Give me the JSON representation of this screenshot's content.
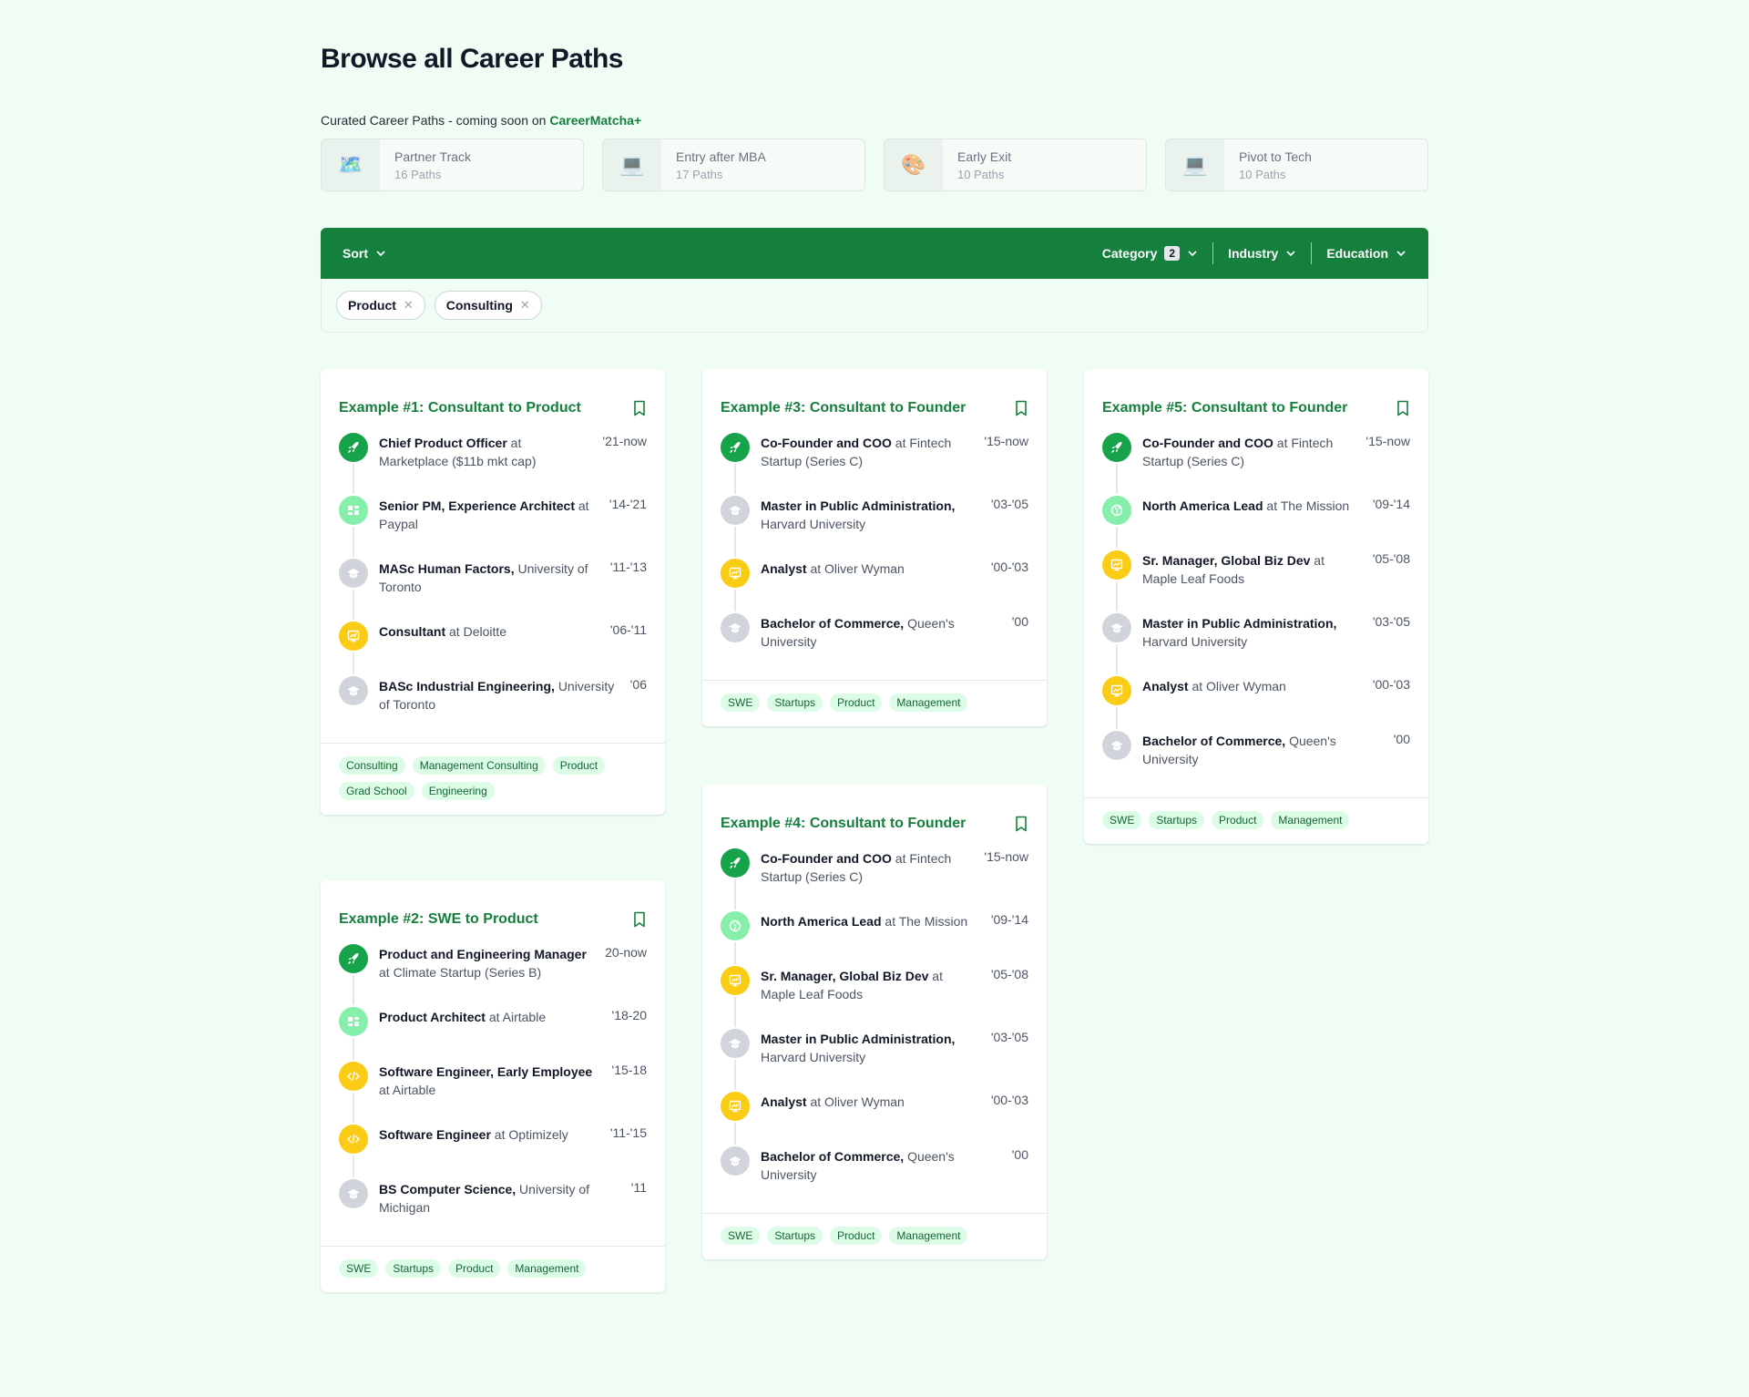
{
  "page_title": "Browse all Career Paths",
  "curated": {
    "prefix": "Curated Career Paths - coming soon on ",
    "brand": "CareerMatcha+"
  },
  "curated_paths": [
    {
      "name": "Partner Track",
      "count": "16 Paths",
      "icon": "🗺️"
    },
    {
      "name": "Entry after MBA",
      "count": "17 Paths",
      "icon": "💻"
    },
    {
      "name": "Early Exit",
      "count": "10 Paths",
      "icon": "🎨"
    },
    {
      "name": "Pivot to Tech",
      "count": "10 Paths",
      "icon": "💻"
    }
  ],
  "filterbar": {
    "sort": "Sort",
    "category": "Category",
    "category_count": "2",
    "industry": "Industry",
    "education": "Education"
  },
  "active_filters": [
    "Product",
    "Consulting"
  ],
  "colors": {
    "brand": "#15803d",
    "background": "#f0fdf4",
    "tag_bg": "#dcfce7"
  },
  "cards": [
    {
      "title": "Example #1: Consultant to Product",
      "items": [
        {
          "icon": "rocket",
          "role": "Chief Product Officer",
          "sep": " at ",
          "org": "Marketplace ($11b mkt cap)",
          "date": "'21-now"
        },
        {
          "icon": "board",
          "role": "Senior PM, Experience Architect",
          "sep": " at ",
          "org": "Paypal",
          "date": "'14-'21"
        },
        {
          "icon": "grad",
          "role": "MASc Human Factors,",
          "sep": " ",
          "org": "University of Toronto",
          "date": "'11-'13"
        },
        {
          "icon": "chart",
          "role": "Consultant",
          "sep": " at ",
          "org": "Deloitte",
          "date": "'06-'11"
        },
        {
          "icon": "grad",
          "role": "BASc Industrial Engineering,",
          "sep": " ",
          "org": "University of Toronto",
          "date": "'06"
        }
      ],
      "tags": [
        "Consulting",
        "Management Consulting",
        "Product",
        "Grad School",
        "Engineering"
      ]
    },
    {
      "title": "Example #2: SWE to Product",
      "items": [
        {
          "icon": "rocket",
          "role": "Product and Engineering Manager",
          "sep": " at ",
          "org": "Climate Startup (Series B)",
          "date": "20-now"
        },
        {
          "icon": "board",
          "role": "Product Architect",
          "sep": " at ",
          "org": "Airtable",
          "date": "'18-20"
        },
        {
          "icon": "code",
          "role": "Software Engineer, Early Employee",
          "sep": " at ",
          "org": "Airtable",
          "date": "'15-18"
        },
        {
          "icon": "code",
          "role": "Software Engineer",
          "sep": " at ",
          "org": "Optimizely",
          "date": "'11-'15"
        },
        {
          "icon": "grad",
          "role": "BS Computer Science,",
          "sep": " ",
          "org": "University of Michigan",
          "date": "'11"
        }
      ],
      "tags": [
        "SWE",
        "Startups",
        "Product",
        "Management"
      ]
    },
    {
      "title": "Example #3: Consultant to Founder",
      "items": [
        {
          "icon": "rocket",
          "role": "Co-Founder and COO",
          "sep": " at ",
          "org": "Fintech Startup (Series C)",
          "date": "'15-now"
        },
        {
          "icon": "grad",
          "role": "Master in Public Administration,",
          "sep": " ",
          "org": "Harvard University",
          "date": "'03-'05"
        },
        {
          "icon": "chart",
          "role": "Analyst",
          "sep": " at ",
          "org": "Oliver Wyman",
          "date": "'00-'03"
        },
        {
          "icon": "grad",
          "role": "Bachelor of Commerce,",
          "sep": " ",
          "org": "Queen's University",
          "date": "'00"
        }
      ],
      "tags": [
        "SWE",
        "Startups",
        "Product",
        "Management"
      ]
    },
    {
      "title": "Example #4: Consultant to Founder",
      "items": [
        {
          "icon": "rocket",
          "role": "Co-Founder and COO",
          "sep": " at ",
          "org": "Fintech Startup (Series C)",
          "date": "'15-now"
        },
        {
          "icon": "globe",
          "role": "North America Lead",
          "sep": " at ",
          "org": "The Mission",
          "date": "'09-'14"
        },
        {
          "icon": "chart",
          "role": "Sr. Manager, Global Biz Dev",
          "sep": " at ",
          "org": "Maple Leaf Foods",
          "date": "'05-'08"
        },
        {
          "icon": "grad",
          "role": "Master in Public Administration,",
          "sep": " ",
          "org": "Harvard University",
          "date": "'03-'05"
        },
        {
          "icon": "chart",
          "role": "Analyst",
          "sep": " at ",
          "org": "Oliver Wyman",
          "date": "'00-'03"
        },
        {
          "icon": "grad",
          "role": "Bachelor of Commerce,",
          "sep": " ",
          "org": "Queen's University",
          "date": "'00"
        }
      ],
      "tags": [
        "SWE",
        "Startups",
        "Product",
        "Management"
      ]
    },
    {
      "title": "Example #5: Consultant to Founder",
      "items": [
        {
          "icon": "rocket",
          "role": "Co-Founder and COO",
          "sep": " at ",
          "org": "Fintech Startup (Series C)",
          "date": "'15-now"
        },
        {
          "icon": "globe",
          "role": "North America Lead",
          "sep": " at ",
          "org": "The Mission",
          "date": "'09-'14"
        },
        {
          "icon": "chart",
          "role": "Sr. Manager, Global Biz Dev",
          "sep": " at ",
          "org": "Maple Leaf Foods",
          "date": "'05-'08"
        },
        {
          "icon": "grad",
          "role": "Master in Public Administration,",
          "sep": " ",
          "org": "Harvard University",
          "date": "'03-'05"
        },
        {
          "icon": "chart",
          "role": "Analyst",
          "sep": " at ",
          "org": "Oliver Wyman",
          "date": "'00-'03"
        },
        {
          "icon": "grad",
          "role": "Bachelor of Commerce,",
          "sep": " ",
          "org": "Queen's University",
          "date": "'00"
        }
      ],
      "tags": [
        "SWE",
        "Startups",
        "Product",
        "Management"
      ]
    }
  ]
}
